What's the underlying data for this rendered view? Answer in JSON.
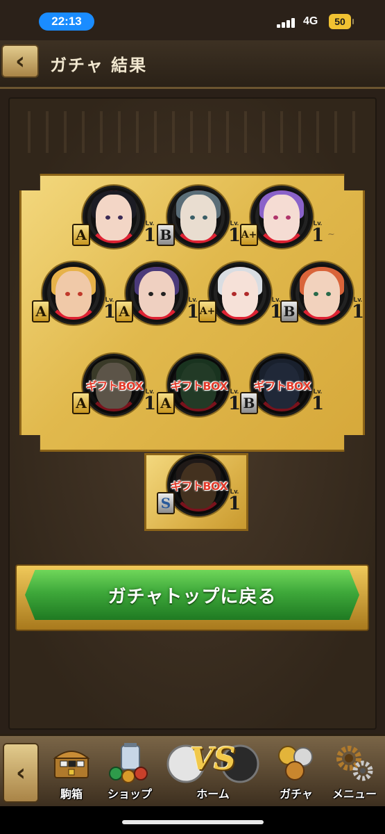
{
  "status_bar": {
    "time": "22:13",
    "network": "4G",
    "battery": "50"
  },
  "header": {
    "title": "ガチャ 結果"
  },
  "results": [
    {
      "rank": "A",
      "level_label": "Lv.",
      "level": "1",
      "gift": false
    },
    {
      "rank": "B",
      "level_label": "Lv.",
      "level": "1",
      "gift": false
    },
    {
      "rank": "A+",
      "level_label": "Lv.",
      "level": "1",
      "gift": false
    },
    {
      "rank": "A",
      "level_label": "Lv.",
      "level": "1",
      "gift": false
    },
    {
      "rank": "A",
      "level_label": "Lv.",
      "level": "1",
      "gift": false
    },
    {
      "rank": "A+",
      "level_label": "Lv.",
      "level": "1",
      "gift": false
    },
    {
      "rank": "B",
      "level_label": "Lv.",
      "level": "1",
      "gift": false
    },
    {
      "rank": "A",
      "level_label": "Lv.",
      "level": "1",
      "gift": true,
      "gift_label": "ギフトBOX"
    },
    {
      "rank": "A",
      "level_label": "Lv.",
      "level": "1",
      "gift": true,
      "gift_label": "ギフトBOX"
    },
    {
      "rank": "B",
      "level_label": "Lv.",
      "level": "1",
      "gift": true,
      "gift_label": "ギフトBOX"
    }
  ],
  "featured": {
    "rank": "S",
    "level_label": "Lv.",
    "level": "1",
    "gift_label": "ギフトBOX"
  },
  "return_button": {
    "label": "ガチャトップに戻る"
  },
  "bottom_nav": {
    "items": [
      {
        "label": "駒箱"
      },
      {
        "label": "ショップ"
      },
      {
        "label": "ホーム",
        "emblem": "VS"
      },
      {
        "label": "ガチャ"
      },
      {
        "label": "メニュー"
      }
    ]
  },
  "colors": {
    "accent_green": "#3ea83a",
    "gold": "#e1b94d",
    "gift_red": "#e23a2a",
    "time_pill": "#1a8cff",
    "battery": "#f1c232"
  }
}
